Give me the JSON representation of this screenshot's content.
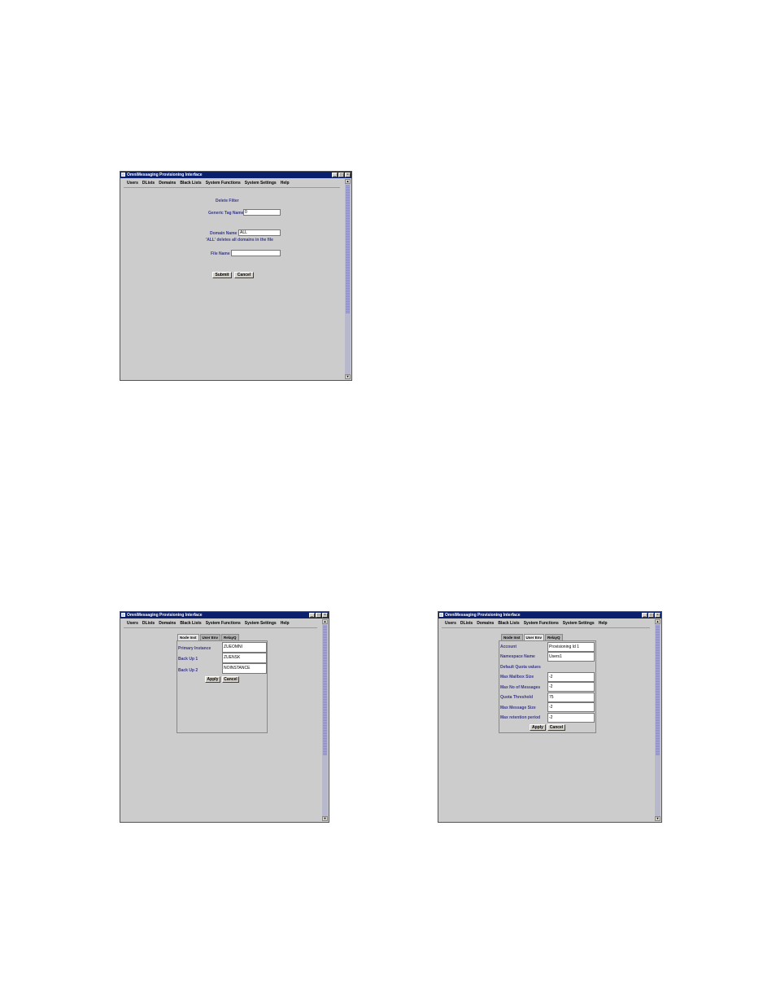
{
  "app": {
    "title": "OmniMessaging Provisioning Interface"
  },
  "window_buttons": {
    "minimize": "_",
    "maximize": "□",
    "close": "×"
  },
  "menu": [
    "Users",
    "DLists",
    "Domains",
    "Black Lists",
    "System Functions",
    "System Settings",
    "Help"
  ],
  "scroll_arrows": {
    "up": "▲",
    "down": "▼"
  },
  "window1": {
    "heading": "Delete Filter",
    "generic_tag_label": "Generic Tag Name",
    "generic_tag_value": "0",
    "domain_label": "Domain Name",
    "domain_value": "ALL",
    "domain_note": "'ALL' deletes all domains in the file",
    "file_label": "File Name",
    "file_value": "",
    "submit": "Submit",
    "cancel": "Cancel"
  },
  "window2": {
    "tabs": [
      "Node Inst",
      "User Env",
      "RelayQ"
    ],
    "rows": [
      {
        "label": "Primary Instance",
        "value": "ZUEOMNI"
      },
      {
        "label": "Back Up 1",
        "value": "ZUENSK"
      },
      {
        "label": "Back Up 2",
        "value": "NOINSTANCE"
      }
    ],
    "apply": "Apply",
    "cancel": "Cancel"
  },
  "window3": {
    "tabs": [
      "Node Inst",
      "User Env",
      "RelayQ"
    ],
    "rows": [
      {
        "label": "Account",
        "value": "Provisioning Id 1"
      },
      {
        "label": "Namespace Name",
        "value": "Users1"
      },
      {
        "label": "Default Quota values",
        "value": null
      },
      {
        "label": "Max Mailbox Size",
        "value": "-2"
      },
      {
        "label": "Max No of Messages",
        "value": "-2"
      },
      {
        "label": "Quota Threshold",
        "value": "75"
      },
      {
        "label": "Max Message Size",
        "value": "-2"
      },
      {
        "label": "Max retention period",
        "value": "-2"
      }
    ],
    "apply": "Apply",
    "cancel": "Cancel"
  }
}
